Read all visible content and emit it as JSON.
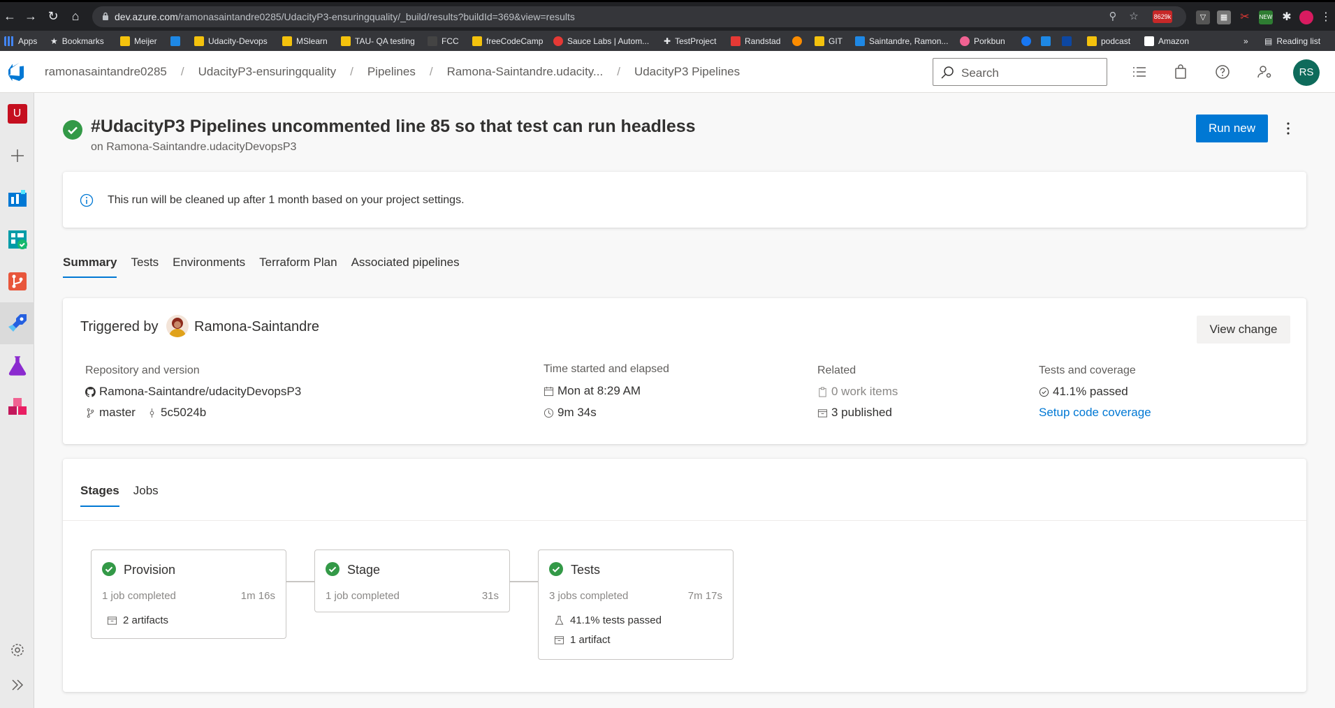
{
  "browser": {
    "url_host": "dev.azure.com",
    "url_path": "/ramonasaintandre0285/UdacityP3-ensuringquality/_build/results?buildId=369&view=results",
    "bookmarks": [
      {
        "label": "Apps",
        "color": "#4285f4"
      },
      {
        "label": "Bookmarks",
        "color": "#e8eaed"
      },
      {
        "label": "Meijer",
        "color": "#f4c20d"
      },
      {
        "label": "",
        "color": "#1e88e5"
      },
      {
        "label": "Udacity-Devops",
        "color": "#f4c20d"
      },
      {
        "label": "MSlearn",
        "color": "#f4c20d"
      },
      {
        "label": "TAU- QA testing",
        "color": "#f4c20d"
      },
      {
        "label": "FCC",
        "color": "#444"
      },
      {
        "label": "freeCodeCamp",
        "color": "#f4c20d"
      },
      {
        "label": "Sauce Labs | Autom...",
        "color": "#e53935"
      },
      {
        "label": "TestProject",
        "color": "#e8eaed"
      },
      {
        "label": "Randstad",
        "color": "#e53935"
      },
      {
        "label": "",
        "color": "#fb8c00"
      },
      {
        "label": "GIT",
        "color": "#f4c20d"
      },
      {
        "label": "Saintandre, Ramon...",
        "color": "#1e88e5"
      },
      {
        "label": "Porkbun",
        "color": "#f06292"
      },
      {
        "label": "",
        "color": "#1877f2"
      },
      {
        "label": "",
        "color": "#1e88e5"
      },
      {
        "label": "",
        "color": "#0d47a1"
      },
      {
        "label": "podcast",
        "color": "#f4c20d"
      },
      {
        "label": "Amazon",
        "color": "#ffffff"
      }
    ],
    "overflow": "»",
    "reading_list": "Reading list",
    "badge": "8629k"
  },
  "header": {
    "breadcrumbs": [
      "ramonasaintandre0285",
      "UdacityP3-ensuringquality",
      "Pipelines",
      "Ramona-Saintandre.udacity...",
      "UdacityP3 Pipelines"
    ],
    "search_placeholder": "Search",
    "user_initials": "RS"
  },
  "nav": {
    "project_initial": "U"
  },
  "run": {
    "title": "#UdacityP3 Pipelines uncommented line 85 so that test can run headless",
    "subtitle": "on Ramona-Saintandre.udacityDevopsP3",
    "run_new_label": "Run new",
    "notice": "This run will be cleaned up after 1 month based on your project settings."
  },
  "tabs": [
    "Summary",
    "Tests",
    "Environments",
    "Terraform Plan",
    "Associated pipelines"
  ],
  "summary": {
    "triggered_by_label": "Triggered by",
    "triggered_by_name": "Ramona-Saintandre",
    "view_change_label": "View change",
    "repo_heading": "Repository and version",
    "repo_name": "Ramona-Saintandre/udacityDevopsP3",
    "branch": "master",
    "commit": "5c5024b",
    "time_heading": "Time started and elapsed",
    "started": "Mon at 8:29 AM",
    "elapsed": "9m 34s",
    "related_heading": "Related",
    "work_items": "0 work items",
    "published": "3 published",
    "tests_heading": "Tests and coverage",
    "tests_passed": "41.1% passed",
    "setup_coverage": "Setup code coverage"
  },
  "stages_tabs": [
    "Stages",
    "Jobs"
  ],
  "stages": [
    {
      "name": "Provision",
      "jobs": "1 job completed",
      "time": "1m 16s",
      "artifacts": "2 artifacts",
      "tests": ""
    },
    {
      "name": "Stage",
      "jobs": "1 job completed",
      "time": "31s",
      "artifacts": "",
      "tests": ""
    },
    {
      "name": "Tests",
      "jobs": "3 jobs completed",
      "time": "7m 17s",
      "artifacts": "1 artifact",
      "tests": "41.1% tests passed"
    }
  ]
}
